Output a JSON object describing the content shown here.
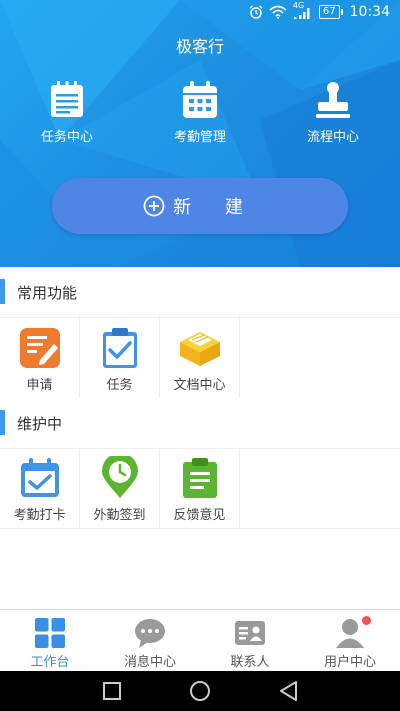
{
  "status_bar": {
    "network": "4G",
    "battery": "67",
    "time": "10:34"
  },
  "header": {
    "title": "极客行",
    "quick_actions": [
      {
        "label": "任务中心",
        "icon": "task-list-icon"
      },
      {
        "label": "考勤管理",
        "icon": "calendar-icon"
      },
      {
        "label": "流程中心",
        "icon": "stamp-icon"
      }
    ],
    "new_button_label": "新 建"
  },
  "sections": [
    {
      "title": "常用功能",
      "items": [
        {
          "label": "申请",
          "icon": "apply-icon"
        },
        {
          "label": "任务",
          "icon": "clipboard-check-icon"
        },
        {
          "label": "文档中心",
          "icon": "document-box-icon"
        }
      ]
    },
    {
      "title": "维护中",
      "items": [
        {
          "label": "考勤打卡",
          "icon": "calendar-check-icon"
        },
        {
          "label": "外勤签到",
          "icon": "location-clock-icon"
        },
        {
          "label": "反馈意见",
          "icon": "feedback-icon"
        }
      ]
    }
  ],
  "bottom_nav": [
    {
      "label": "工作台",
      "icon": "grid-icon",
      "active": true
    },
    {
      "label": "消息中心",
      "icon": "chat-icon",
      "active": false
    },
    {
      "label": "联系人",
      "icon": "contact-card-icon",
      "active": false
    },
    {
      "label": "用户中心",
      "icon": "user-icon",
      "active": false,
      "badge": true
    }
  ],
  "colors": {
    "accent": "#3a8ee6",
    "header_gradient_start": "#23a6f0",
    "header_gradient_end": "#167fd8",
    "new_button": "#4f86e6",
    "badge": "#f05050"
  }
}
